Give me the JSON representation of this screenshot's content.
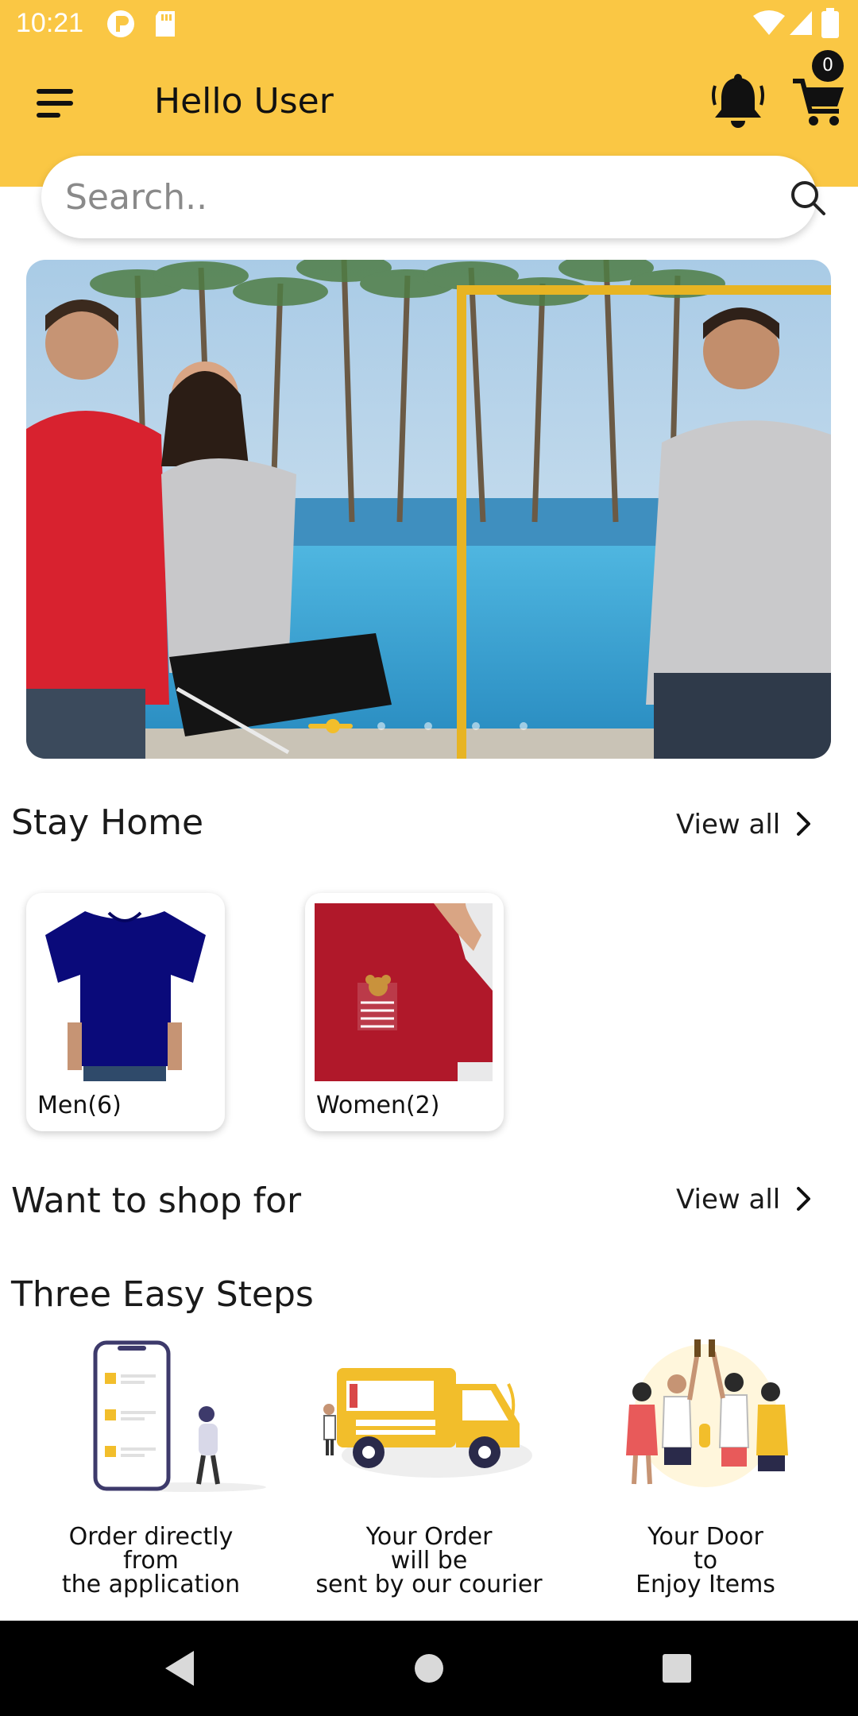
{
  "status_bar": {
    "time": "10:21"
  },
  "header": {
    "greeting": "Hello User",
    "cart_count": "0"
  },
  "search": {
    "placeholder": "Search.."
  },
  "sections": {
    "stay_home": {
      "title": "Stay Home",
      "view_all": "View all"
    },
    "want_to_shop": {
      "title": "Want to shop for",
      "view_all": "View all"
    },
    "three_steps": {
      "title": "Three Easy Steps"
    }
  },
  "categories": [
    {
      "label": "Men(6)",
      "icon": "blue-tshirt"
    },
    {
      "label": "Women(2)",
      "icon": "red-tshirt"
    }
  ],
  "steps": [
    {
      "line1": "Order directly",
      "line2": "from",
      "line3": "the application",
      "icon": "phone-order-illustration"
    },
    {
      "line1": "Your Order",
      "line2": "will be",
      "line3": "sent by our courier",
      "icon": "delivery-truck-illustration"
    },
    {
      "line1": "Your Door",
      "line2": "to",
      "line3": "Enjoy Items",
      "icon": "celebration-illustration"
    }
  ],
  "colors": {
    "brand": "#FAC744",
    "text": "#1a1a1a"
  }
}
